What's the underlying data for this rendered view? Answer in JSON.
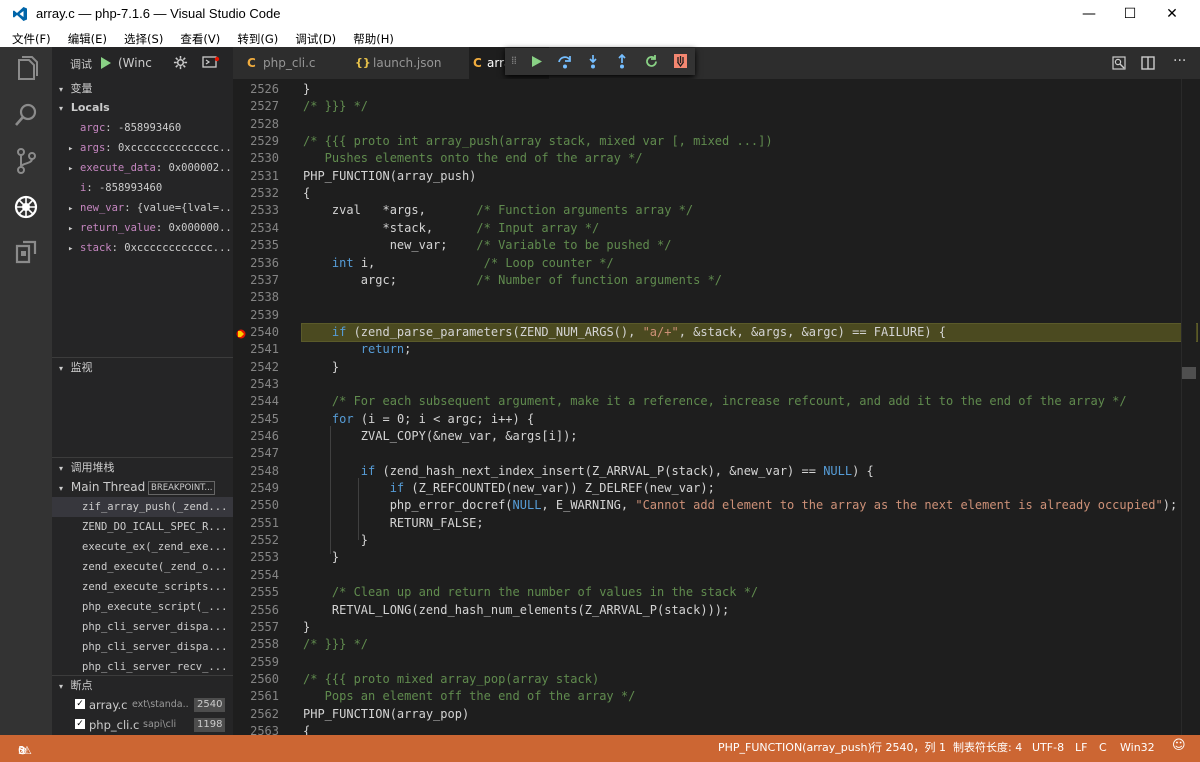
{
  "window": {
    "title": "array.c — php-7.1.6 — Visual Studio Code",
    "minimize": "—",
    "maximize": "☐",
    "close": "✕"
  },
  "menu": [
    "文件(F)",
    "编辑(E)",
    "选择(S)",
    "查看(V)",
    "转到(G)",
    "调试(D)",
    "帮助(H)"
  ],
  "activity": [
    "files-icon",
    "search-icon",
    "source-control-icon",
    "debug-icon",
    "extensions-icon"
  ],
  "debug": {
    "label": "调试",
    "config": "(Winc"
  },
  "sidebar": {
    "variables_header": "变量",
    "locals_label": "Locals",
    "locals": [
      {
        "expand": "",
        "name": "argc",
        "value": "-858993460"
      },
      {
        "expand": "▸",
        "name": "args",
        "value": "0xcccccccccccccc..."
      },
      {
        "expand": "▸",
        "name": "execute_data",
        "value": "0x000002..."
      },
      {
        "expand": "",
        "name": "i",
        "value": "-858993460"
      },
      {
        "expand": "▸",
        "name": "new_var",
        "value": "{value={lval=..."
      },
      {
        "expand": "▸",
        "name": "return_value",
        "value": "0x000000..."
      },
      {
        "expand": "▸",
        "name": "stack",
        "value": "0xcccccccccccc..."
      }
    ],
    "watch_header": "监视",
    "callstack_header": "调用堆栈",
    "thread": "Main Thread",
    "thread_badge": "BREAKPOINT...",
    "frames": [
      "zif_array_push(_zend...",
      "ZEND_DO_ICALL_SPEC_R...",
      "execute_ex(_zend_exe...",
      "zend_execute(_zend_o...",
      "zend_execute_scripts...",
      "php_execute_script(_...",
      "php_cli_server_dispa...",
      "php_cli_server_dispa...",
      "php_cli_server_recv_..."
    ],
    "breakpoints_header": "断点",
    "breakpoints": [
      {
        "file": "array.c",
        "path": "ext\\standa..",
        "line": "2540"
      },
      {
        "file": "php_cli.c",
        "path": "sapi\\cli",
        "line": "1198"
      }
    ]
  },
  "tabs": [
    {
      "icon": "C",
      "label": "php_cli.c"
    },
    {
      "icon": "{}",
      "label": "launch.json"
    },
    {
      "icon": "C",
      "label": "arra"
    }
  ],
  "code_lines": [
    {
      "n": "2526",
      "segs": [
        [
          "p",
          "}"
        ]
      ]
    },
    {
      "n": "2527",
      "segs": [
        [
          "c",
          "/* }}} */"
        ]
      ]
    },
    {
      "n": "2528",
      "segs": []
    },
    {
      "n": "2529",
      "segs": [
        [
          "c",
          "/* {{{ proto int array_push(array stack, mixed var [, mixed ...])"
        ]
      ]
    },
    {
      "n": "2530",
      "segs": [
        [
          "c",
          "   Pushes elements onto the end of the array */"
        ]
      ]
    },
    {
      "n": "2531",
      "segs": [
        [
          "p",
          "PHP_FUNCTION(array_push)"
        ]
      ]
    },
    {
      "n": "2532",
      "segs": [
        [
          "p",
          "{"
        ]
      ]
    },
    {
      "n": "2533",
      "segs": [
        [
          "p",
          "    zval   *args,       "
        ],
        [
          "c",
          "/* Function arguments array */"
        ]
      ]
    },
    {
      "n": "2534",
      "segs": [
        [
          "p",
          "           *stack,      "
        ],
        [
          "c",
          "/* Input array */"
        ]
      ]
    },
    {
      "n": "2535",
      "segs": [
        [
          "p",
          "            new_var;    "
        ],
        [
          "c",
          "/* Variable to be pushed */"
        ]
      ]
    },
    {
      "n": "2536",
      "segs": [
        [
          "p",
          "    "
        ],
        [
          "k",
          "int"
        ],
        [
          "p",
          " i,               "
        ],
        [
          "c",
          "/* Loop counter */"
        ]
      ]
    },
    {
      "n": "2537",
      "segs": [
        [
          "p",
          "        argc;           "
        ],
        [
          "c",
          "/* Number of function arguments */"
        ]
      ]
    },
    {
      "n": "2538",
      "segs": []
    },
    {
      "n": "2539",
      "segs": []
    },
    {
      "n": "2540",
      "segs": [
        [
          "p",
          "    "
        ],
        [
          "k",
          "if"
        ],
        [
          "p",
          " (zend_parse_parameters(ZEND_NUM_ARGS(), "
        ],
        [
          "s",
          "\"a/+\""
        ],
        [
          "p",
          ", &stack, &args, &argc) == FAILURE) {"
        ]
      ]
    },
    {
      "n": "2541",
      "segs": [
        [
          "p",
          "        "
        ],
        [
          "k",
          "return"
        ],
        [
          "p",
          ";"
        ]
      ]
    },
    {
      "n": "2542",
      "segs": [
        [
          "p",
          "    }"
        ]
      ]
    },
    {
      "n": "2543",
      "segs": []
    },
    {
      "n": "2544",
      "segs": [
        [
          "c",
          "    /* For each subsequent argument, make it a reference, increase refcount, and add it to the end of the array */"
        ]
      ]
    },
    {
      "n": "2545",
      "segs": [
        [
          "p",
          "    "
        ],
        [
          "k",
          "for"
        ],
        [
          "p",
          " (i = 0; i < argc; i++) {"
        ]
      ]
    },
    {
      "n": "2546",
      "segs": [
        [
          "p",
          "        ZVAL_COPY(&new_var, &args[i]);"
        ]
      ]
    },
    {
      "n": "2547",
      "segs": []
    },
    {
      "n": "2548",
      "segs": [
        [
          "p",
          "        "
        ],
        [
          "k",
          "if"
        ],
        [
          "p",
          " (zend_hash_next_index_insert(Z_ARRVAL_P(stack), &new_var) == "
        ],
        [
          "k",
          "NULL"
        ],
        [
          "p",
          ") {"
        ]
      ]
    },
    {
      "n": "2549",
      "segs": [
        [
          "p",
          "            "
        ],
        [
          "k",
          "if"
        ],
        [
          "p",
          " (Z_REFCOUNTED(new_var)) Z_DELREF(new_var);"
        ]
      ]
    },
    {
      "n": "2550",
      "segs": [
        [
          "p",
          "            php_error_docref("
        ],
        [
          "k",
          "NULL"
        ],
        [
          "p",
          ", E_WARNING, "
        ],
        [
          "s",
          "\"Cannot add element to the array as the next element is already occupied\""
        ],
        [
          "p",
          ");"
        ]
      ]
    },
    {
      "n": "2551",
      "segs": [
        [
          "p",
          "            RETURN_FALSE;"
        ]
      ]
    },
    {
      "n": "2552",
      "segs": [
        [
          "p",
          "        }"
        ]
      ]
    },
    {
      "n": "2553",
      "segs": [
        [
          "p",
          "    }"
        ]
      ]
    },
    {
      "n": "2554",
      "segs": []
    },
    {
      "n": "2555",
      "segs": [
        [
          "c",
          "    /* Clean up and return the number of values in the stack */"
        ]
      ]
    },
    {
      "n": "2556",
      "segs": [
        [
          "p",
          "    RETVAL_LONG(zend_hash_num_elements(Z_ARRVAL_P(stack)));"
        ]
      ]
    },
    {
      "n": "2557",
      "segs": [
        [
          "p",
          "}"
        ]
      ]
    },
    {
      "n": "2558",
      "segs": [
        [
          "c",
          "/* }}} */"
        ]
      ]
    },
    {
      "n": "2559",
      "segs": []
    },
    {
      "n": "2560",
      "segs": [
        [
          "c",
          "/* {{{ proto mixed array_pop(array stack)"
        ]
      ]
    },
    {
      "n": "2561",
      "segs": [
        [
          "c",
          "   Pops an element off the end of the array */"
        ]
      ]
    },
    {
      "n": "2562",
      "segs": [
        [
          "p",
          "PHP_FUNCTION(array_pop)"
        ]
      ]
    },
    {
      "n": "2563",
      "segs": [
        [
          "p",
          "{"
        ]
      ]
    }
  ],
  "status": {
    "errors": "3",
    "warnings": "0",
    "function": "PHP_FUNCTION(array_push)",
    "position": "行 2540，列 1",
    "tabsize": "制表符长度: 4",
    "encoding": "UTF-8",
    "eol": "LF",
    "language": "C",
    "platform": "Win32"
  },
  "colors": {
    "statusbar": "#cc6633",
    "breakpoint": "#e51400",
    "current_line": "#4b4a20"
  }
}
